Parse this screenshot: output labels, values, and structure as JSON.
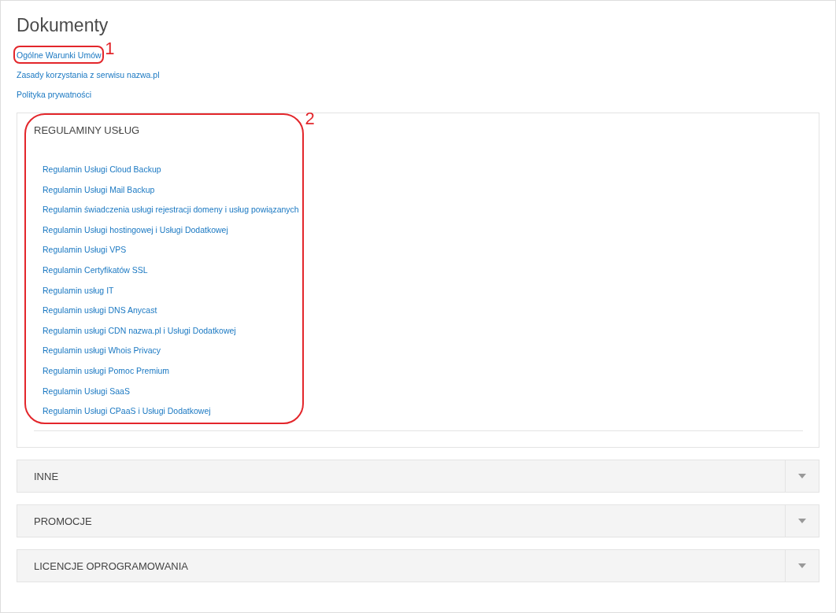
{
  "title": "Dokumenty",
  "links": [
    {
      "label": "Ogólne Warunki Umów",
      "annotation": "1"
    },
    {
      "label": "Zasady korzystania z serwisu nazwa.pl"
    },
    {
      "label": "Polityka prywatności"
    }
  ],
  "sections": [
    {
      "title": "REGULAMINY USŁUG",
      "expanded": true,
      "annotation": "2",
      "links": [
        "Regulamin Usługi Cloud Backup",
        "Regulamin Usługi Mail Backup",
        "Regulamin świadczenia usługi rejestracji domeny i usług powiązanych",
        "Regulamin Usługi hostingowej i Usługi Dodatkowej",
        "Regulamin Usługi VPS",
        "Regulamin Certyfikatów SSL",
        "Regulamin usług IT",
        "Regulamin usługi DNS Anycast",
        "Regulamin usługi CDN nazwa.pl i Usługi Dodatkowej",
        "Regulamin usługi Whois Privacy",
        "Regulamin usługi Pomoc Premium",
        "Regulamin Usługi SaaS",
        "Regulamin Usługi CPaaS i Usługi Dodatkowej"
      ]
    },
    {
      "title": "INNE",
      "expanded": false
    },
    {
      "title": "PROMOCJE",
      "expanded": false
    },
    {
      "title": "LICENCJE OPROGRAMOWANIA",
      "expanded": false
    }
  ]
}
